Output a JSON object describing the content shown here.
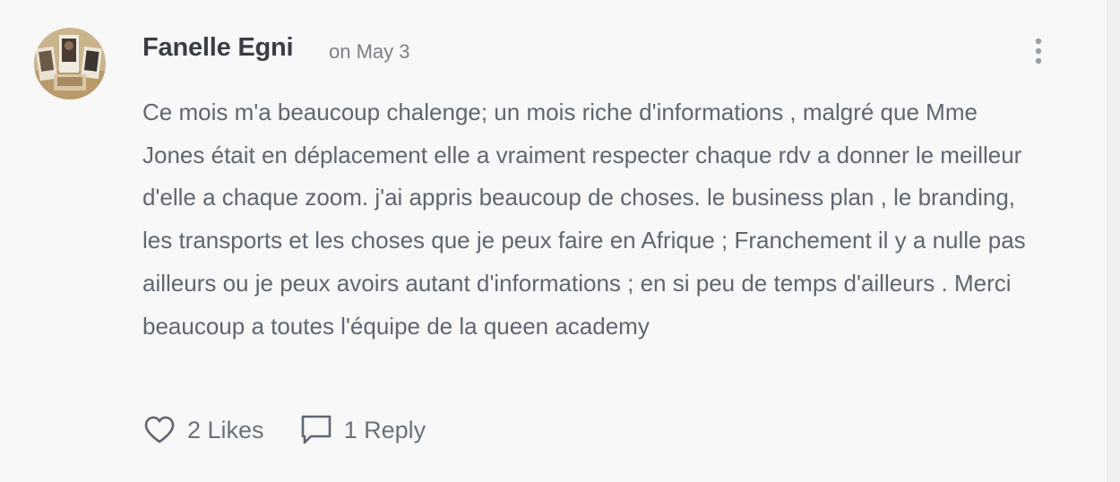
{
  "comment": {
    "author": "Fanelle Egni",
    "date": "on May 3",
    "text": "Ce mois m'a beaucoup chalenge; un mois riche d'informations , malgré que Mme Jones était en déplacement elle a vraiment respecter chaque rdv a donner le meilleur d'elle a chaque zoom. j'ai appris beaucoup de choses. le business plan , le branding, les transports et les choses que je peux faire en Afrique ; Franchement il y a nulle pas ailleurs ou je peux avoirs autant d'informations ; en si peu de temps d'ailleurs . Merci beaucoup  a toutes l'équipe de la queen academy",
    "likes_label": "2 Likes",
    "reply_label": "1 Reply"
  },
  "icons": {
    "menu": "more-vertical-icon",
    "like": "heart-icon",
    "reply": "speech-bubble-icon"
  },
  "colors": {
    "background": "#f8f8f8",
    "author": "#3a3d45",
    "text": "#5f6670",
    "muted": "#7b8087",
    "icon": "#5f6670"
  }
}
